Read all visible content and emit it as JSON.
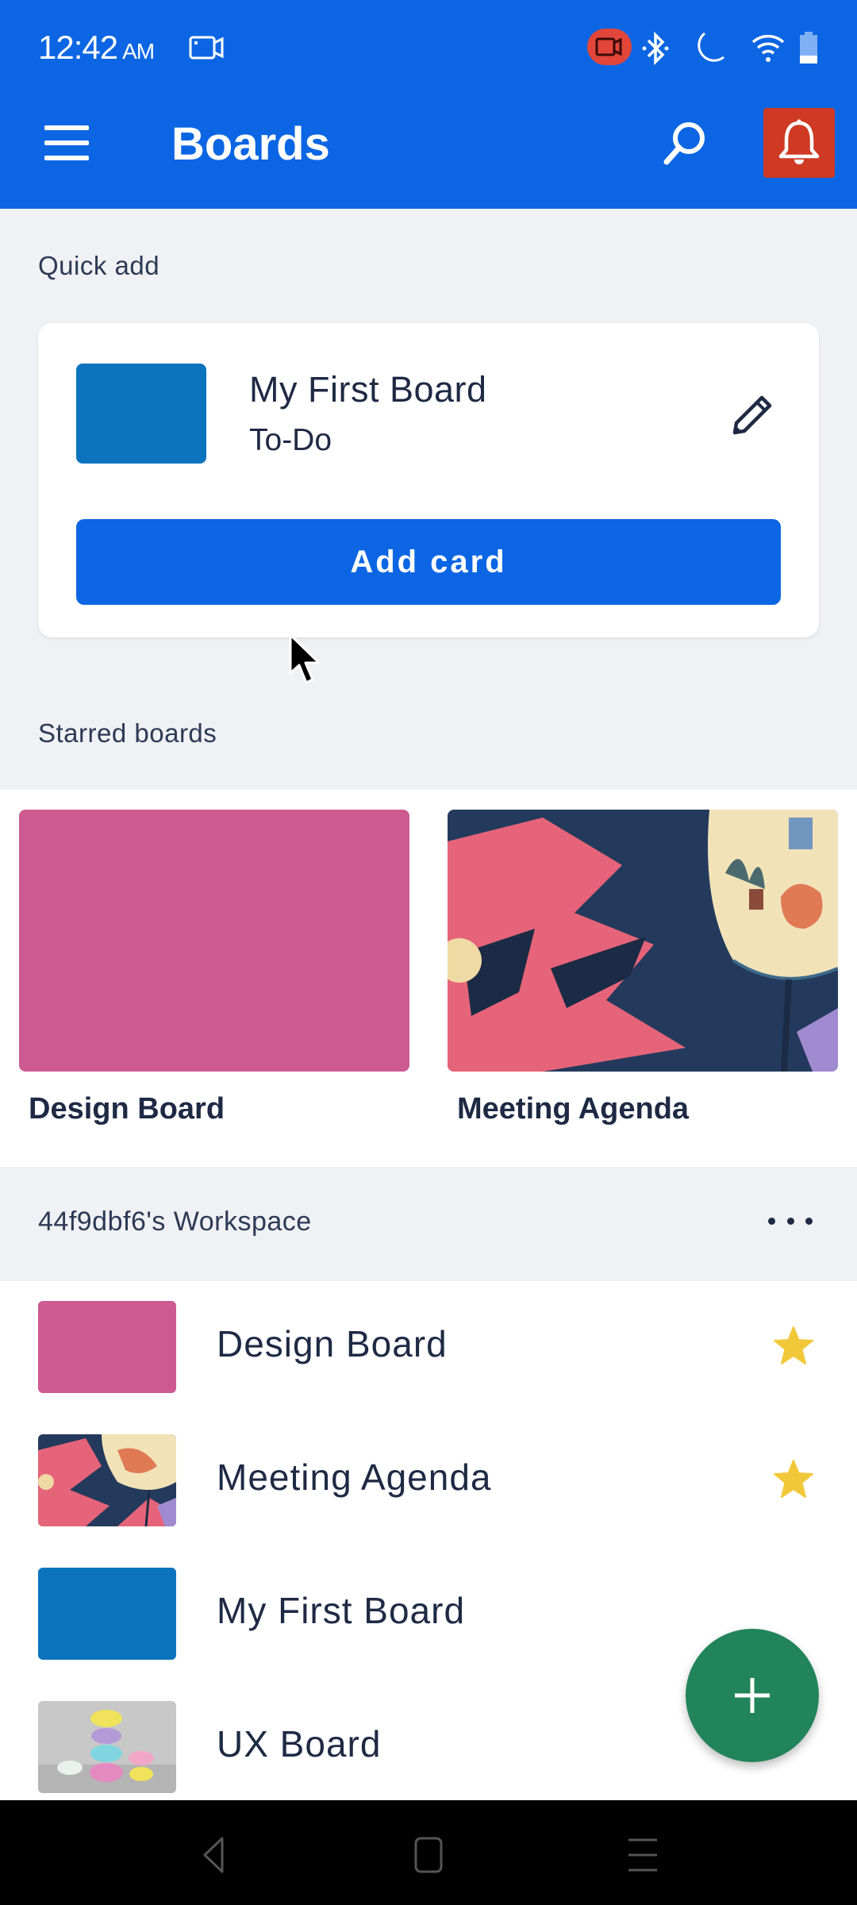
{
  "status_bar": {
    "time": "12:42",
    "ampm": "AM",
    "icons": [
      "screen-record-icon",
      "recording-indicator-icon",
      "bluetooth-icon",
      "do-not-disturb-moon-icon",
      "wifi-icon",
      "battery-icon"
    ]
  },
  "toolbar": {
    "title": "Boards",
    "menu_icon": "hamburger-menu-icon",
    "search_icon": "search-icon",
    "notifications_icon": "bell-icon"
  },
  "quick_add": {
    "section_label": "Quick add",
    "board_name": "My First Board",
    "list_name": "To-Do",
    "board_color": "#0c74bf",
    "edit_icon": "pencil-icon",
    "add_button_label": "Add card"
  },
  "starred": {
    "section_label": "Starred boards",
    "boards": [
      {
        "name": "Design Board",
        "background": "pink-solid",
        "color": "#cd5a91"
      },
      {
        "name": "Meeting Agenda",
        "background": "illustration-image"
      }
    ]
  },
  "workspace": {
    "name": "44f9dbf6's Workspace",
    "more_icon": "more-horizontal-icon",
    "boards": [
      {
        "name": "Design Board",
        "background": "pink-solid",
        "color": "#cd5a91",
        "starred": true
      },
      {
        "name": "Meeting Agenda",
        "background": "illustration-image",
        "starred": true
      },
      {
        "name": "My First Board",
        "background": "blue-solid",
        "color": "#0c74bf",
        "starred": false
      },
      {
        "name": "UX Board",
        "background": "macarons-photo",
        "starred": false
      }
    ]
  },
  "fab": {
    "icon": "plus-icon"
  },
  "nav_bar": {
    "buttons": [
      "back-icon",
      "home-icon",
      "recents-icon"
    ]
  },
  "colors": {
    "primary": "#0c66e4",
    "notification_bg": "#cf3a24",
    "star": "#f2c83b",
    "fab": "#22845a",
    "text": "#1e2a44",
    "page_bg": "#f0f1f4"
  }
}
